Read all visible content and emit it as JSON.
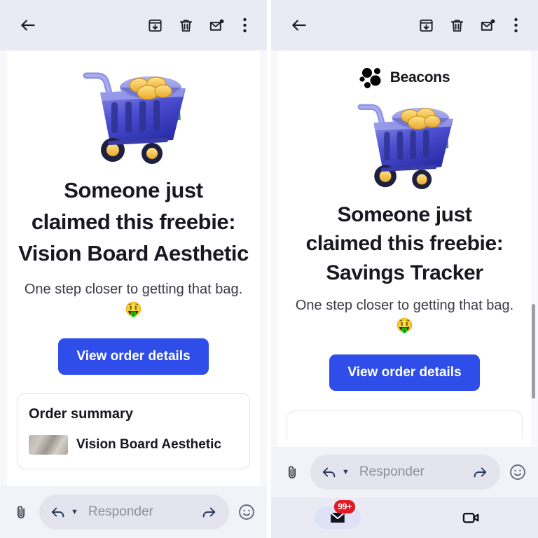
{
  "appbar": {
    "back_icon": "arrow-left-icon",
    "archive_icon": "archive-icon",
    "delete_icon": "trash-icon",
    "unread_icon": "mark-unread-icon",
    "more_icon": "more-vertical-icon"
  },
  "left_panel": {
    "headline_line1": "Someone just",
    "headline_line2": "claimed this freebie:",
    "product": "Vision Board Aesthetic",
    "subline": "One step closer to getting that bag. 🤑",
    "cta_label": "View order details",
    "summary_title": "Order summary",
    "summary_item": "Vision Board Aesthetic",
    "hero_icon": "shopping-cart-with-money-illustration"
  },
  "right_panel": {
    "brand_name": "Beacons",
    "brand_logo_icon": "beacons-dots-logo",
    "headline_line1": "Someone just",
    "headline_line2": "claimed this freebie:",
    "product": "Savings Tracker",
    "subline": "One step closer to getting that bag. 🤑",
    "cta_label": "View order details",
    "hero_icon": "shopping-cart-with-money-illustration"
  },
  "reply": {
    "attach_icon": "paperclip-icon",
    "reply_icon": "reply-arrow-icon",
    "dropdown_icon": "chevron-down-icon",
    "placeholder": "Responder",
    "forward_icon": "forward-arrow-icon",
    "emoji_icon": "emoji-smiley-icon"
  },
  "bottom_nav": {
    "mail_icon": "mail-icon",
    "mail_badge": "99+",
    "meet_icon": "video-camera-icon"
  },
  "colors": {
    "accent_blue": "#2f4de8",
    "appbar_bg": "#eaeaf4",
    "badge_red": "#e01b24"
  }
}
